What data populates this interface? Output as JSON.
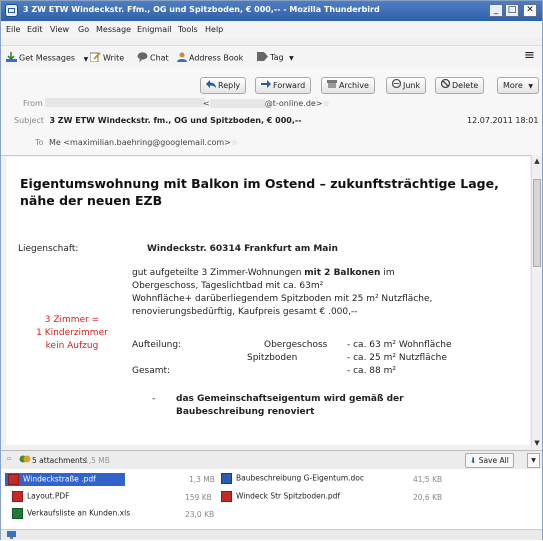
{
  "window": {
    "title": "3 ZW ETW Windeckstr.        Ffm.,  OG und Spitzboden, €         000,-- - Mozilla Thunderbird",
    "min": "_",
    "max": "□",
    "close": "✕"
  },
  "menu": [
    "Eile",
    "Edit",
    "View",
    "Go",
    "Message",
    "Enigmail",
    "Tools",
    "Help"
  ],
  "toolbar": {
    "get_messages": "Get Messages",
    "write": "Write",
    "chat": "Chat",
    "address_book": "Address Book",
    "tag": "Tag",
    "menu_icon": "≡"
  },
  "actions": {
    "reply": "Reply",
    "forward": "Forward",
    "archive": "Archive",
    "junk": "Junk",
    "delete": "Delete",
    "more": "More"
  },
  "header": {
    "from_label": "From",
    "from_value": "@t-online.de>",
    "subject_label": "Subject",
    "subject_value": "3 ZW ETW Windeckstr.        fm.,  OG und Spitzboden, €         000,--",
    "date": "12.07.2011 18:01",
    "to_label": "To",
    "to_value": "Me <maximilian.baehring@googlemail.com>"
  },
  "body": {
    "headline": "Eigentumswohnung mit Balkon im Ostend – zukunftsträchtige Lage, nähe der neuen EZB",
    "liegenschaft_label": "Liegenschaft:",
    "address": "Windeckstr.        60314 Frankfurt am Main",
    "desc_line1_a": "gut aufgeteilte 3 Zimmer-Wohnungen ",
    "desc_line1_b": "mit 2 Balkonen",
    "desc_line1_c": " im",
    "desc_line2": "       Obergeschoss, Tageslichtbad mit ca. 63m²",
    "desc_line3": "Wohnfläche+ darüberliegendem Spitzboden mit 25 m² Nutzfläche,",
    "desc_line4": "renovierungsbedürftig, Kaufpreis gesamt €         .000,--",
    "note1": "3 Zimmer =",
    "note2": "1 Kinderzimmer",
    "note3": "kein Aufzug",
    "aufteilung_label": "Aufteilung:",
    "og_label": "Obergeschoss",
    "og_value": "- ca. 63 m² Wohnfläche",
    "sb_label": "Spitzboden",
    "sb_value": "- ca. 25 m² Nutzfläche",
    "gesamt_label": "Gesamt:",
    "gesamt_value": "- ca. 88 m²",
    "bullet": "-",
    "renov_line1": "das Gemeinschaftseigentum wird gemäß der",
    "renov_line2": "Baubeschreibung renoviert"
  },
  "attachments": {
    "summary": "5 attachments",
    "total_size": "1,5 MB",
    "save_all": "Save All",
    "items": [
      {
        "name": "Windeckstraße        .pdf",
        "size": "1,3 MB"
      },
      {
        "name": "Baubeschreibung G-Eigentum.doc",
        "size": "41,5 KB"
      },
      {
        "name": "Layout.PDF",
        "size": "159 KB"
      },
      {
        "name": "Windeck Str Spitzboden.pdf",
        "size": "20,6 KB"
      },
      {
        "name": "Verkaufsliste an Kunden.xls",
        "size": "23,0 KB"
      }
    ]
  },
  "colors": {
    "titlebar": "#2f5fa8",
    "note_red": "#d02020",
    "selection": "#3163c9"
  }
}
